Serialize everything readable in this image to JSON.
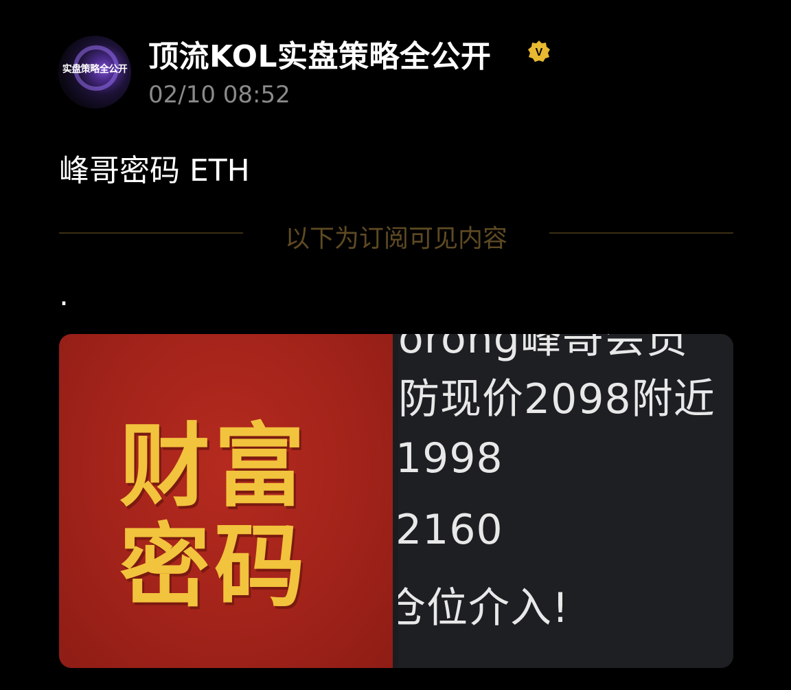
{
  "post": {
    "avatar_text": "实盘策略全公开",
    "author_name": "顶流KOL实盘策略全公开",
    "verified_badge": "V",
    "timestamp": "02/10 08:52",
    "title": "峰哥密码 ETH",
    "divider_label": "以下为订阅可见内容",
    "body_text": "."
  },
  "image": {
    "poster_line1": "财富",
    "poster_line2": "密码",
    "chat_lines": [
      "orong峰哥会员",
      "防现价2098附近",
      "1998",
      "2160",
      "仓位介入!"
    ]
  },
  "colors": {
    "background": "#000000",
    "verified_badge": "#e8b931",
    "divider": "#5e4a23",
    "poster_red": "#a2231a",
    "poster_gold": "#f2c33d"
  }
}
